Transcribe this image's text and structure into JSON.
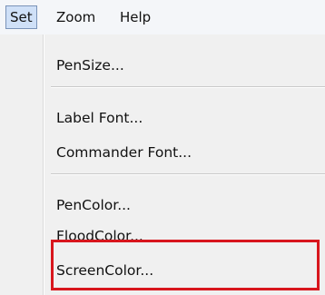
{
  "menubar": {
    "items": [
      {
        "label": "Set"
      },
      {
        "label": "Zoom"
      },
      {
        "label": "Help"
      }
    ]
  },
  "dropdown": {
    "items": [
      {
        "label": "PenSize..."
      },
      {
        "label": "Label Font..."
      },
      {
        "label": "Commander Font..."
      },
      {
        "label": "PenColor..."
      },
      {
        "label": "FloodColor..."
      },
      {
        "label": "ScreenColor..."
      }
    ]
  },
  "colors": {
    "highlight_box": "#d8161d",
    "active_menu_bg": "#cfe0f7",
    "menu_bg": "#f0f0f0"
  }
}
